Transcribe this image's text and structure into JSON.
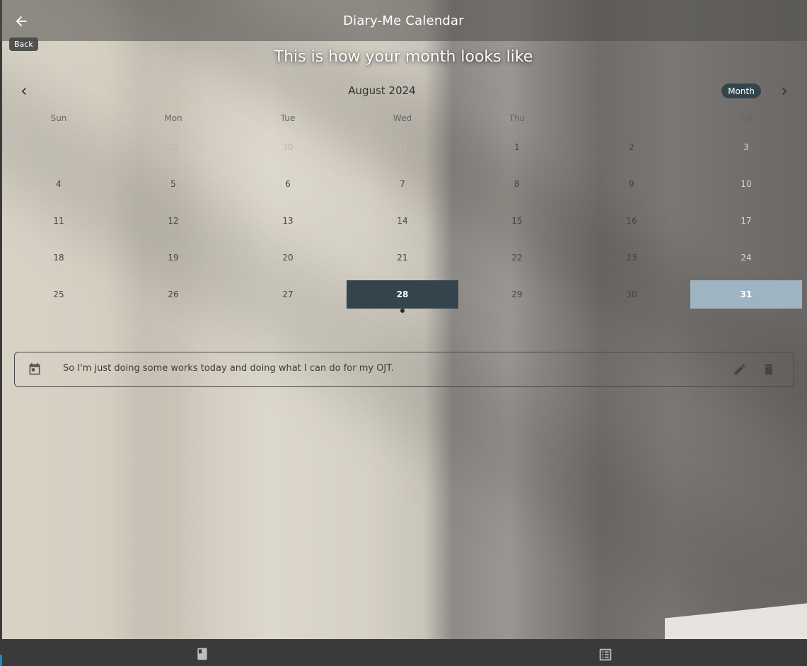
{
  "appbar": {
    "title": "Diary-Me Calendar",
    "back_tooltip": "Back"
  },
  "subtitle": "This is how your month looks like",
  "calendar": {
    "month_label": "August 2024",
    "view_mode": "Month",
    "weekdays": [
      "Sun",
      "Mon",
      "Tue",
      "Wed",
      "Thu",
      "",
      "Sat"
    ],
    "weeks": [
      [
        "28",
        "29",
        "30",
        "31",
        "1",
        "2",
        "3"
      ],
      [
        "4",
        "5",
        "6",
        "7",
        "8",
        "9",
        "10"
      ],
      [
        "11",
        "12",
        "13",
        "14",
        "15",
        "16",
        "17"
      ],
      [
        "18",
        "19",
        "20",
        "21",
        "22",
        "23",
        "24"
      ],
      [
        "25",
        "26",
        "27",
        "28",
        "29",
        "30",
        "31"
      ]
    ],
    "selected_day": "28",
    "today_day": "31",
    "colors": {
      "selected": "#34444d",
      "today": "#9fb4c2"
    }
  },
  "event": {
    "icon": "calendar-icon",
    "text": "So I'm just doing some works today and doing what I can do for my OJT."
  },
  "bottom_nav": {
    "items": [
      "book-icon",
      "list-icon"
    ]
  }
}
